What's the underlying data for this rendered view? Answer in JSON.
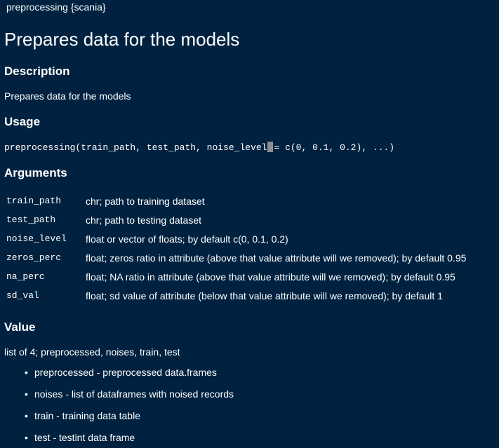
{
  "header": {
    "package_line": "preprocessing {scania}"
  },
  "title": "Prepares data for the models",
  "description": {
    "heading": "Description",
    "text": "Prepares data for the models"
  },
  "usage": {
    "heading": "Usage",
    "code_before_cursor": "preprocessing(train_path, test_path, noise_level",
    "code_after_cursor": "= c(0, 0.1, 0.2), ...)"
  },
  "arguments": {
    "heading": "Arguments",
    "rows": [
      {
        "name": "train_path",
        "desc": "chr; path to training dataset"
      },
      {
        "name": "test_path",
        "desc": "chr; path to testing dataset"
      },
      {
        "name": "noise_level",
        "desc": "float or vector of floats; by default c(0, 0.1, 0.2)"
      },
      {
        "name": "zeros_perc",
        "desc": "float; zeros ratio in attribute (above that value attribute will we removed); by default 0.95"
      },
      {
        "name": "na_perc",
        "desc": "float; NA ratio in attribute (above that value attribute will we removed); by default 0.95"
      },
      {
        "name": "sd_val",
        "desc": "float; sd value of attribute (below that value attribute will we removed); by default 1"
      }
    ]
  },
  "value": {
    "heading": "Value",
    "text": "list of 4; preprocessed, noises, train, test",
    "items": [
      "preprocessed - preprocessed data.frames",
      "noises - list of dataframes with noised records",
      "train - training data table",
      "test - testint data frame"
    ]
  }
}
